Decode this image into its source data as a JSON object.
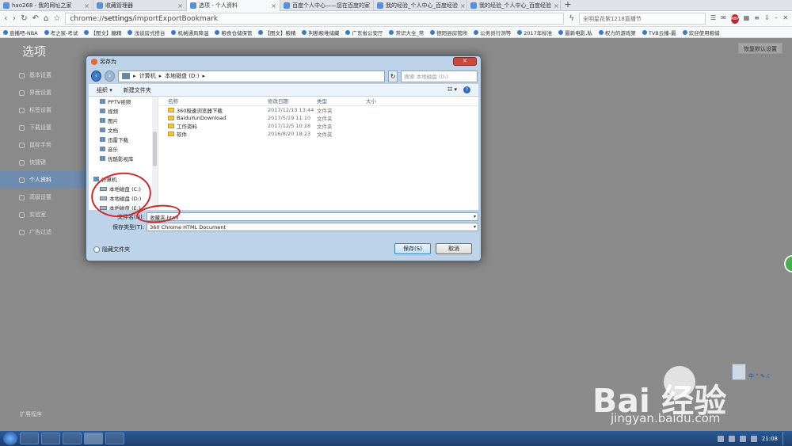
{
  "browser": {
    "tabs": [
      {
        "label": "hao268 - 我的网址之家",
        "active": false
      },
      {
        "label": "收藏管理器",
        "active": false
      },
      {
        "label": "选项 - 个人资料",
        "active": true
      },
      {
        "label": "百度个人中心——您在百度的家",
        "active": false
      },
      {
        "label": "我的经验_个人中心_百度经验",
        "active": false
      },
      {
        "label": "我的经验_个人中心_百度经验",
        "active": false
      }
    ],
    "newtab": "+",
    "address_prefix": "chrome://",
    "address_bold": "settings",
    "address_rest": "/importExportBookmark",
    "search_text": "全明星花絮1218直播节",
    "bookmarks": [
      "直播吧-NBA",
      "考之家-考试",
      "【图文】糖精",
      "浅谈房式搭台",
      "机械通风降温",
      "粮食仓储保管",
      "【图文】粮精",
      "判断粮堆储藏",
      "广东省公安厅",
      "常识大全_常",
      "德阳县房管所",
      "公务员行测等",
      "2017年标准",
      "最新电影,私",
      "权力的游戏第",
      "TVB云播-最",
      "欢迎使用粮储"
    ]
  },
  "settings": {
    "title": "选项",
    "restore_label": "恢复默认设置",
    "sidebar": [
      {
        "label": "基本设置",
        "active": false
      },
      {
        "label": "界面设置",
        "active": false
      },
      {
        "label": "标签设置",
        "active": false
      },
      {
        "label": "下载设置",
        "active": false
      },
      {
        "label": "鼠标手势",
        "active": false
      },
      {
        "label": "快捷键",
        "active": false
      },
      {
        "label": "个人资料",
        "active": true
      },
      {
        "label": "高级设置",
        "active": false
      },
      {
        "label": "实验室",
        "active": false
      },
      {
        "label": "广告过滤",
        "active": false
      }
    ],
    "extensions_link": "扩展程序"
  },
  "dialog": {
    "title": "另存为",
    "close": "✕",
    "breadcrumb": [
      "计算机",
      "本地磁盘 (D:)"
    ],
    "search_placeholder": "搜索 本地磁盘 (D:)",
    "organize": "组织 ▾",
    "new_folder": "新建文件夹",
    "tree": [
      {
        "label": "PPTV视频",
        "kind": "lib"
      },
      {
        "label": "视频",
        "kind": "lib"
      },
      {
        "label": "图片",
        "kind": "lib"
      },
      {
        "label": "文档",
        "kind": "lib"
      },
      {
        "label": "迅雷下载",
        "kind": "lib"
      },
      {
        "label": "音乐",
        "kind": "lib"
      },
      {
        "label": "优酷影视库",
        "kind": "lib"
      },
      {
        "label": "",
        "kind": "gap"
      },
      {
        "label": "计算机",
        "kind": "computer"
      },
      {
        "label": "本地磁盘 (C:)",
        "kind": "drive"
      },
      {
        "label": "本地磁盘 (D:)",
        "kind": "drive"
      },
      {
        "label": "本地磁盘 (E:)",
        "kind": "drive"
      }
    ],
    "columns": {
      "name": "名称",
      "date": "修改日期",
      "type": "类型",
      "size": "大小"
    },
    "files": [
      {
        "name": "360极速浏览器下载",
        "date": "2017/12/13 13:44",
        "type": "文件夹"
      },
      {
        "name": "BaiduYunDownload",
        "date": "2017/5/19 11:10",
        "type": "文件夹"
      },
      {
        "name": "工作资料",
        "date": "2017/12/5 10:28",
        "type": "文件夹"
      },
      {
        "name": "软件",
        "date": "2016/8/20 18:23",
        "type": "文件夹"
      }
    ],
    "filename_label": "文件名(N):",
    "filename_value": "收藏夹.html",
    "filetype_label": "保存类型(T):",
    "filetype_value": "360 Chrome HTML Document",
    "hide_folders": "隐藏文件夹",
    "save": "保存(S)",
    "cancel": "取消"
  },
  "watermark": {
    "brand": "Bai 经验",
    "url": "jingyan.baidu.com"
  },
  "ime": "中 ° ✎ ☾",
  "taskbar": {
    "time": "21:08"
  }
}
